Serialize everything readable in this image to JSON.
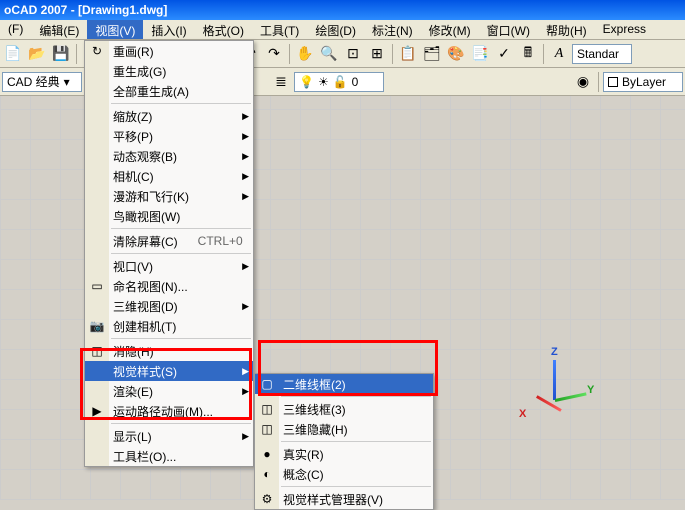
{
  "title": "oCAD 2007 - [Drawing1.dwg]",
  "menubar": [
    {
      "label": "(F)",
      "key": "F"
    },
    {
      "label": "编辑(E)",
      "key": "E"
    },
    {
      "label": "视图(V)",
      "key": "V",
      "active": true
    },
    {
      "label": "插入(I)",
      "key": "I"
    },
    {
      "label": "格式(O)",
      "key": "O"
    },
    {
      "label": "工具(T)",
      "key": "T"
    },
    {
      "label": "绘图(D)",
      "key": "D"
    },
    {
      "label": "标注(N)",
      "key": "N"
    },
    {
      "label": "修改(M)",
      "key": "M"
    },
    {
      "label": "窗口(W)",
      "key": "W"
    },
    {
      "label": "帮助(H)",
      "key": "H"
    },
    {
      "label": "Express",
      "key": ""
    }
  ],
  "toolbar2": {
    "workspace_combo": "CAD 经典",
    "layer_combo": "0",
    "props_combo": "ByLayer",
    "style_combo": "Standar"
  },
  "view_menu": {
    "items": [
      {
        "label": "重画(R)",
        "icon": "↻"
      },
      {
        "label": "重生成(G)"
      },
      {
        "label": "全部重生成(A)"
      },
      {
        "sep": true
      },
      {
        "label": "缩放(Z)",
        "sub": true
      },
      {
        "label": "平移(P)",
        "sub": true
      },
      {
        "label": "动态观察(B)",
        "sub": true
      },
      {
        "label": "相机(C)",
        "sub": true
      },
      {
        "label": "漫游和飞行(K)",
        "sub": true
      },
      {
        "label": "鸟瞰视图(W)"
      },
      {
        "sep": true
      },
      {
        "label": "清除屏幕(C)",
        "shortcut": "CTRL+0"
      },
      {
        "sep": true
      },
      {
        "label": "视口(V)",
        "sub": true
      },
      {
        "label": "命名视图(N)...",
        "icon": "▭"
      },
      {
        "label": "三维视图(D)",
        "sub": true
      },
      {
        "label": "创建相机(T)",
        "icon": "📷"
      },
      {
        "sep": true
      },
      {
        "label": "消隐(H)",
        "icon": "◫"
      },
      {
        "label": "视觉样式(S)",
        "sub": true,
        "highlight": true
      },
      {
        "label": "渲染(E)",
        "sub": true
      },
      {
        "label": "运动路径动画(M)...",
        "icon": "▶"
      },
      {
        "sep": true
      },
      {
        "label": "显示(L)",
        "sub": true
      },
      {
        "label": "工具栏(O)..."
      }
    ]
  },
  "submenu": {
    "items": [
      {
        "label": "二维线框(2)",
        "icon": "▢",
        "highlight": true
      },
      {
        "sep": true
      },
      {
        "label": "三维线框(3)",
        "icon": "◫"
      },
      {
        "label": "三维隐藏(H)",
        "icon": "◫"
      },
      {
        "sep": true
      },
      {
        "label": "真实(R)",
        "icon": "●"
      },
      {
        "label": "概念(C)",
        "icon": "◐"
      },
      {
        "sep": true
      },
      {
        "label": "视觉样式管理器(V)",
        "icon": "⚙"
      }
    ]
  },
  "ucs": {
    "x": "X",
    "y": "Y",
    "z": "Z"
  }
}
